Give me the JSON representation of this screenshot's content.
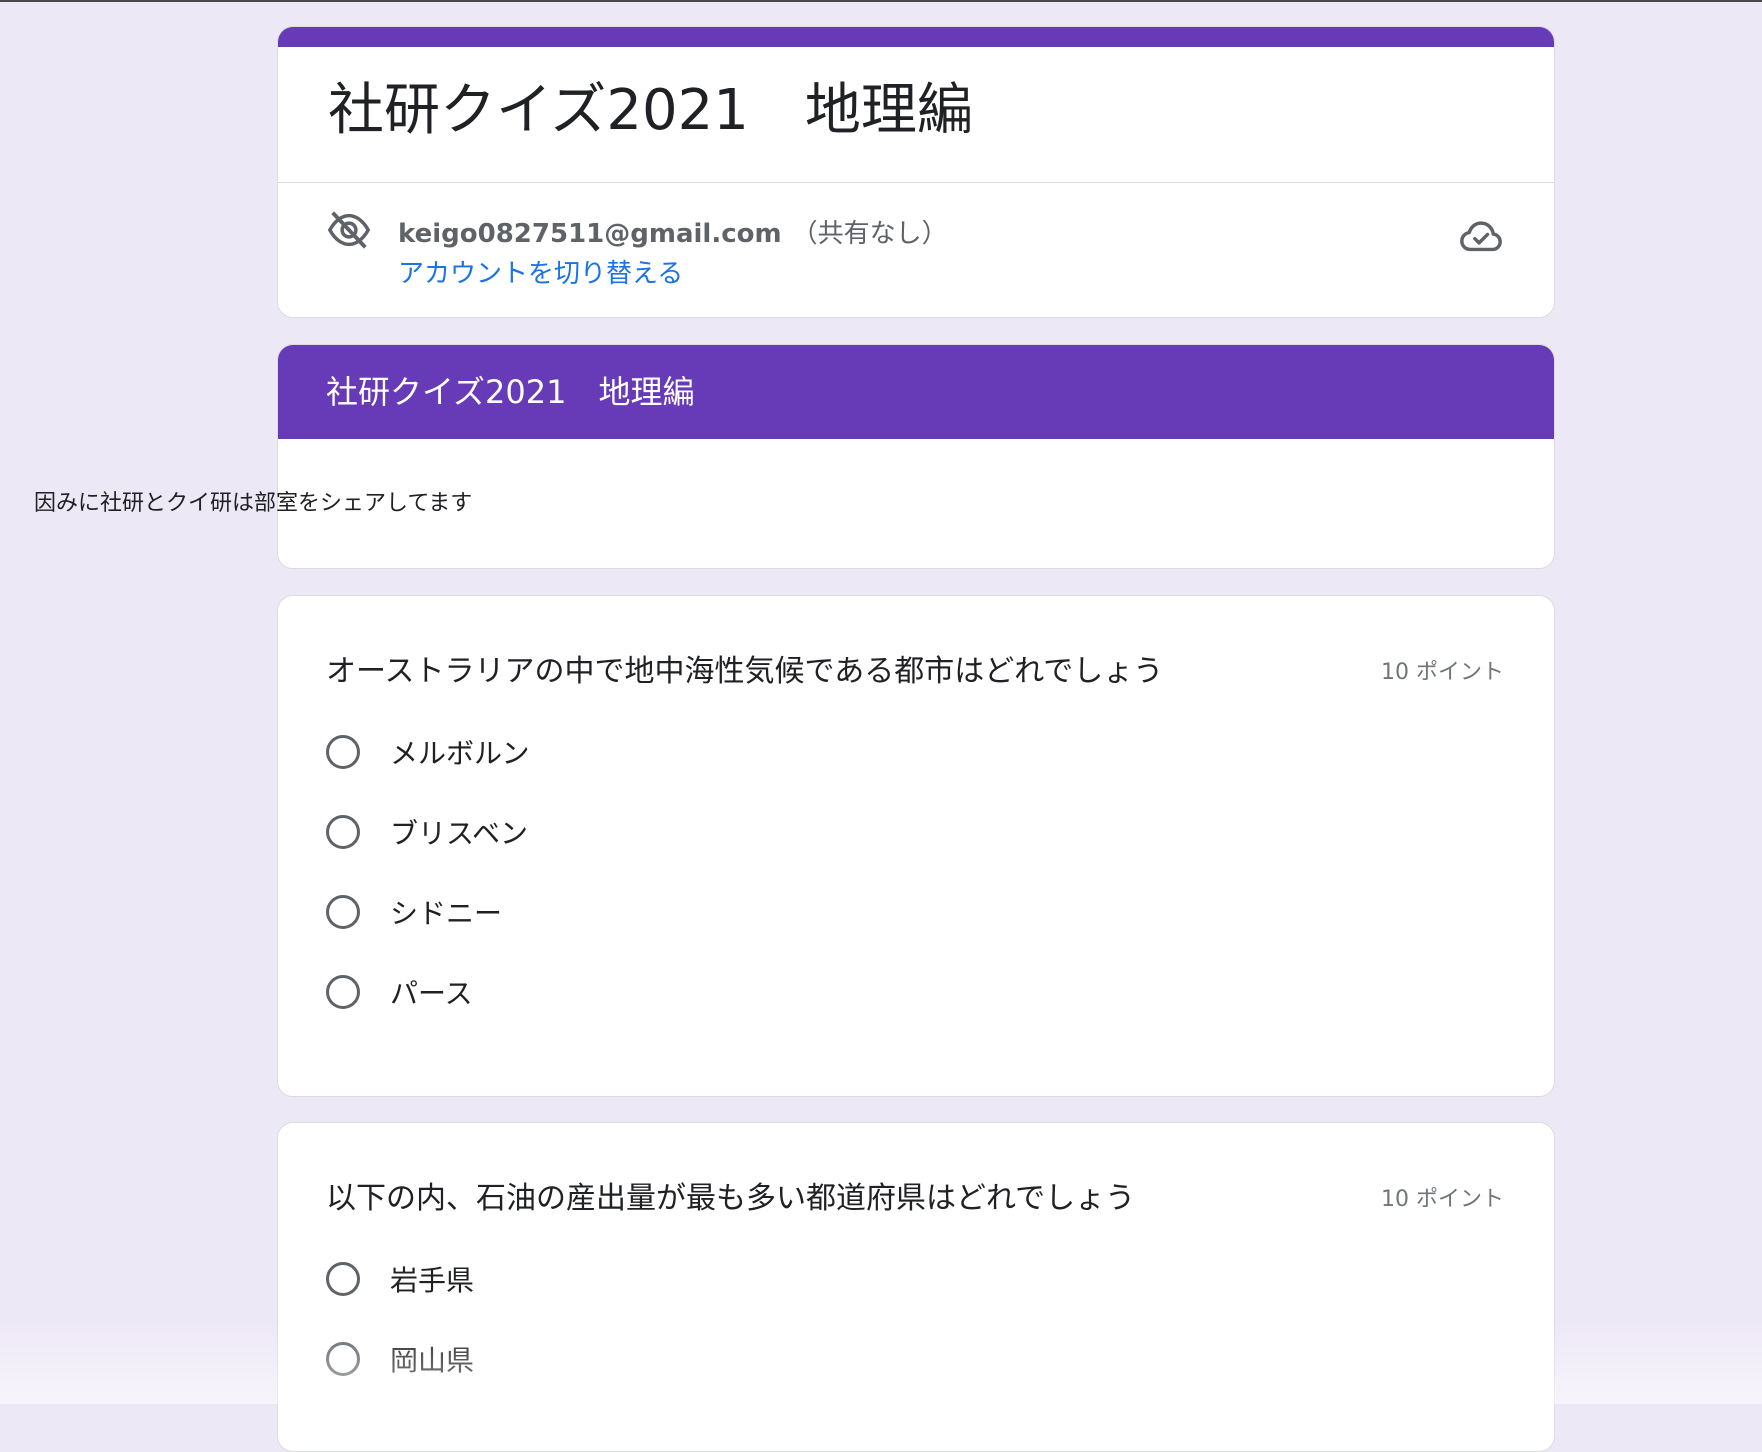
{
  "colors": {
    "accent": "#673ab7",
    "background": "#ede8f6",
    "link": "#1a73e8"
  },
  "form": {
    "title": "社研クイズ2021　地理編",
    "account": {
      "email": "keigo0827511@gmail.com",
      "share_status": "（共有なし）",
      "switch_label": "アカウントを切り替える",
      "privacy_icon": "eye-off-icon",
      "save_icon": "cloud-done-icon"
    }
  },
  "section": {
    "title": "社研クイズ2021　地理編",
    "description": "因みに社研とクイ研は部室をシェアしてます"
  },
  "questions": [
    {
      "title": "オーストラリアの中で地中海性気候である都市はどれでしょう",
      "points": "10 ポイント",
      "options": [
        "メルボルン",
        "ブリスベン",
        "シドニー",
        "パース"
      ]
    },
    {
      "title": "以下の内、石油の産出量が最も多い都道府県はどれでしょう",
      "points": "10 ポイント",
      "options": [
        "岩手県",
        "岡山県"
      ]
    }
  ]
}
